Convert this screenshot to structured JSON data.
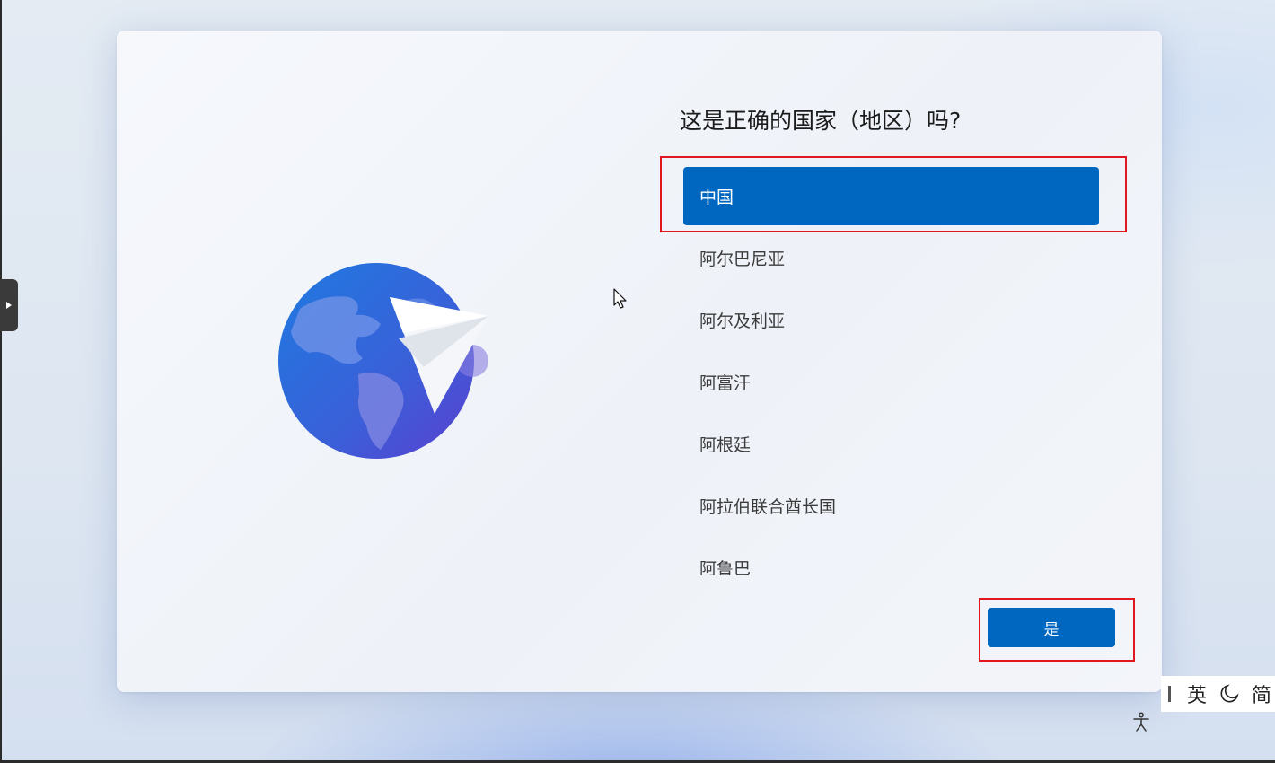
{
  "setup": {
    "heading": "这是正确的国家（地区）吗?",
    "countries": [
      {
        "label": "中国",
        "selected": true
      },
      {
        "label": "阿尔巴尼亚",
        "selected": false
      },
      {
        "label": "阿尔及利亚",
        "selected": false
      },
      {
        "label": "阿富汗",
        "selected": false
      },
      {
        "label": "阿根廷",
        "selected": false
      },
      {
        "label": "阿拉伯联合酋长国",
        "selected": false
      },
      {
        "label": "阿鲁巴",
        "selected": false
      }
    ],
    "confirm_label": "是"
  },
  "ime": {
    "language": "英",
    "script": "简"
  },
  "colors": {
    "accent": "#0067c0",
    "highlight_frame": "#e0171f"
  },
  "icons": {
    "globe": "globe-with-paper-plane",
    "cursor": "arrow-cursor",
    "accessibility": "accessibility-icon",
    "moon": "moon-icon"
  }
}
